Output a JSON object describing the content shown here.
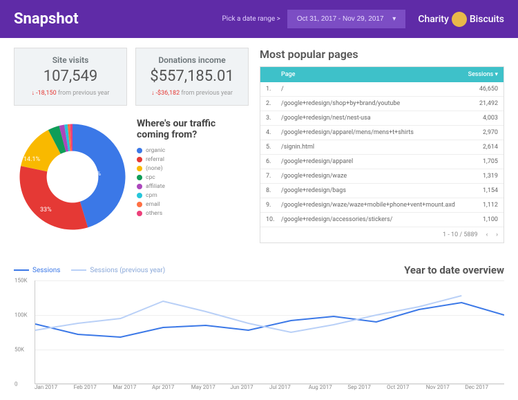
{
  "header": {
    "title": "Snapshot",
    "date_label": "Pick a date range >",
    "date_range": "Oct 31, 2017 - Nov 29, 2017",
    "brand_left": "Charity",
    "brand_right": "Biscuits"
  },
  "stats": {
    "visits": {
      "title": "Site visits",
      "value": "107,549",
      "delta": "-18,150",
      "suffix": "from previous year"
    },
    "donations": {
      "title": "Donations income",
      "value": "$557,185.01",
      "delta": "-$36,182",
      "suffix": "from previous year"
    }
  },
  "traffic": {
    "title": "Where's our traffic coming from?",
    "labels": {
      "organic": "45.3%",
      "referral": "33%",
      "none": "14.1%"
    },
    "legend": [
      {
        "name": "organic",
        "color": "#3b78e7"
      },
      {
        "name": "referral",
        "color": "#e53935"
      },
      {
        "name": "(none)",
        "color": "#f9b900"
      },
      {
        "name": "cpc",
        "color": "#0f9d58"
      },
      {
        "name": "affiliate",
        "color": "#ab47bc"
      },
      {
        "name": "cpm",
        "color": "#26c6da"
      },
      {
        "name": "email",
        "color": "#ff7043"
      },
      {
        "name": "others",
        "color": "#ec407a"
      }
    ]
  },
  "pages": {
    "title": "Most popular pages",
    "head_page": "Page",
    "head_sessions": "Sessions",
    "rows": [
      {
        "n": "1.",
        "page": "/",
        "sessions": "46,650"
      },
      {
        "n": "2.",
        "page": "/google+redesign/shop+by+brand/youtube",
        "sessions": "21,492"
      },
      {
        "n": "3.",
        "page": "/google+redesign/nest/nest-usa",
        "sessions": "4,003"
      },
      {
        "n": "4.",
        "page": "/google+redesign/apparel/mens/mens+t+shirts",
        "sessions": "2,970"
      },
      {
        "n": "5.",
        "page": "/signin.html",
        "sessions": "2,614"
      },
      {
        "n": "6.",
        "page": "/google+redesign/apparel",
        "sessions": "1,705"
      },
      {
        "n": "7.",
        "page": "/google+redesign/waze",
        "sessions": "1,319"
      },
      {
        "n": "8.",
        "page": "/google+redesign/bags",
        "sessions": "1,154"
      },
      {
        "n": "9.",
        "page": "/google+redesign/waze/waze+mobile+phone+vent+mount.axd",
        "sessions": "1,112"
      },
      {
        "n": "10.",
        "page": "/google+redesign/accessories/stickers/",
        "sessions": "1,100"
      }
    ],
    "footer": "1 - 10 / 5889"
  },
  "ytd": {
    "title": "Year to date overview",
    "legend_a": "Sessions",
    "legend_b": "Sessions (previous year)",
    "yticks": [
      "0",
      "50K",
      "100K",
      "150K"
    ],
    "xticks": [
      "Jan 2017",
      "Feb 2017",
      "Mar 2017",
      "Apr 2017",
      "May 2017",
      "Jun 2017",
      "Jul 2017",
      "Aug 2017",
      "Sep 2017",
      "Oct 2017",
      "Nov 2017",
      "Dec 2017"
    ]
  },
  "chart_data": [
    {
      "type": "pie",
      "title": "Where's our traffic coming from?",
      "series": [
        {
          "name": "organic",
          "value": 45.3,
          "color": "#3b78e7"
        },
        {
          "name": "referral",
          "value": 33.0,
          "color": "#e53935"
        },
        {
          "name": "(none)",
          "value": 14.1,
          "color": "#f9b900"
        },
        {
          "name": "cpc",
          "value": 3.5,
          "color": "#0f9d58"
        },
        {
          "name": "affiliate",
          "value": 1.6,
          "color": "#ab47bc"
        },
        {
          "name": "cpm",
          "value": 1.0,
          "color": "#26c6da"
        },
        {
          "name": "email",
          "value": 0.8,
          "color": "#ff7043"
        },
        {
          "name": "others",
          "value": 0.7,
          "color": "#ec407a"
        }
      ]
    },
    {
      "type": "line",
      "title": "Year to date overview",
      "xlabel": "",
      "ylabel": "",
      "ylim": [
        0,
        150000
      ],
      "categories": [
        "Jan 2017",
        "Feb 2017",
        "Mar 2017",
        "Apr 2017",
        "May 2017",
        "Jun 2017",
        "Jul 2017",
        "Aug 2017",
        "Sep 2017",
        "Oct 2017",
        "Nov 2017",
        "Dec 2017"
      ],
      "series": [
        {
          "name": "Sessions",
          "color": "#3b78e7",
          "values": [
            87000,
            72000,
            68000,
            82000,
            85000,
            78000,
            92000,
            98000,
            90000,
            108000,
            118000,
            100000
          ]
        },
        {
          "name": "Sessions (previous year)",
          "color": "#b9d0f7",
          "values": [
            78000,
            88000,
            95000,
            120000,
            105000,
            88000,
            75000,
            86000,
            100000,
            112000,
            128000,
            null
          ]
        }
      ]
    }
  ]
}
